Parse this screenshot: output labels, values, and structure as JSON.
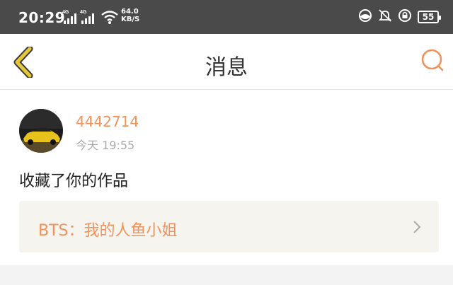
{
  "status_bar": {
    "time": "20:29",
    "net1": "4G",
    "net2": "4G",
    "speed_value": "64.0",
    "speed_unit": "KB/S",
    "battery": "55"
  },
  "header": {
    "title": "消息"
  },
  "message": {
    "username": "4442714",
    "time": "今天 19:55",
    "action": "收藏了你的作品",
    "work_title": "BTS：我的人鱼小姐"
  },
  "colors": {
    "accent": "#f0925a",
    "back_icon": "#e7c73a",
    "status_bg": "#4a4a4a"
  }
}
